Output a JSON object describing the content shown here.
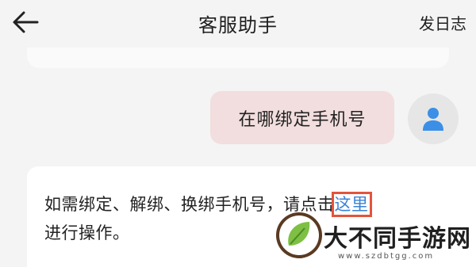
{
  "header": {
    "title": "客服助手",
    "action_label": "发日志",
    "back_icon": "arrow-left-icon"
  },
  "chat": {
    "user_message": "在哪绑定手机号",
    "user_avatar_icon": "user-icon",
    "bot_message_prefix": "如需绑定、解绑、换绑手机号，请点击",
    "bot_link_text": "这里",
    "bot_message_suffix": "进行操作。"
  },
  "watermark": {
    "name": "大不同手游网",
    "url": "www.szdbtgg.com"
  },
  "colors": {
    "background": "#f4f4f4",
    "user_bubble": "#f2dede",
    "link": "#3b82d6",
    "avatar_icon": "#3b8fe6",
    "highlight_box": "#e2543b"
  }
}
